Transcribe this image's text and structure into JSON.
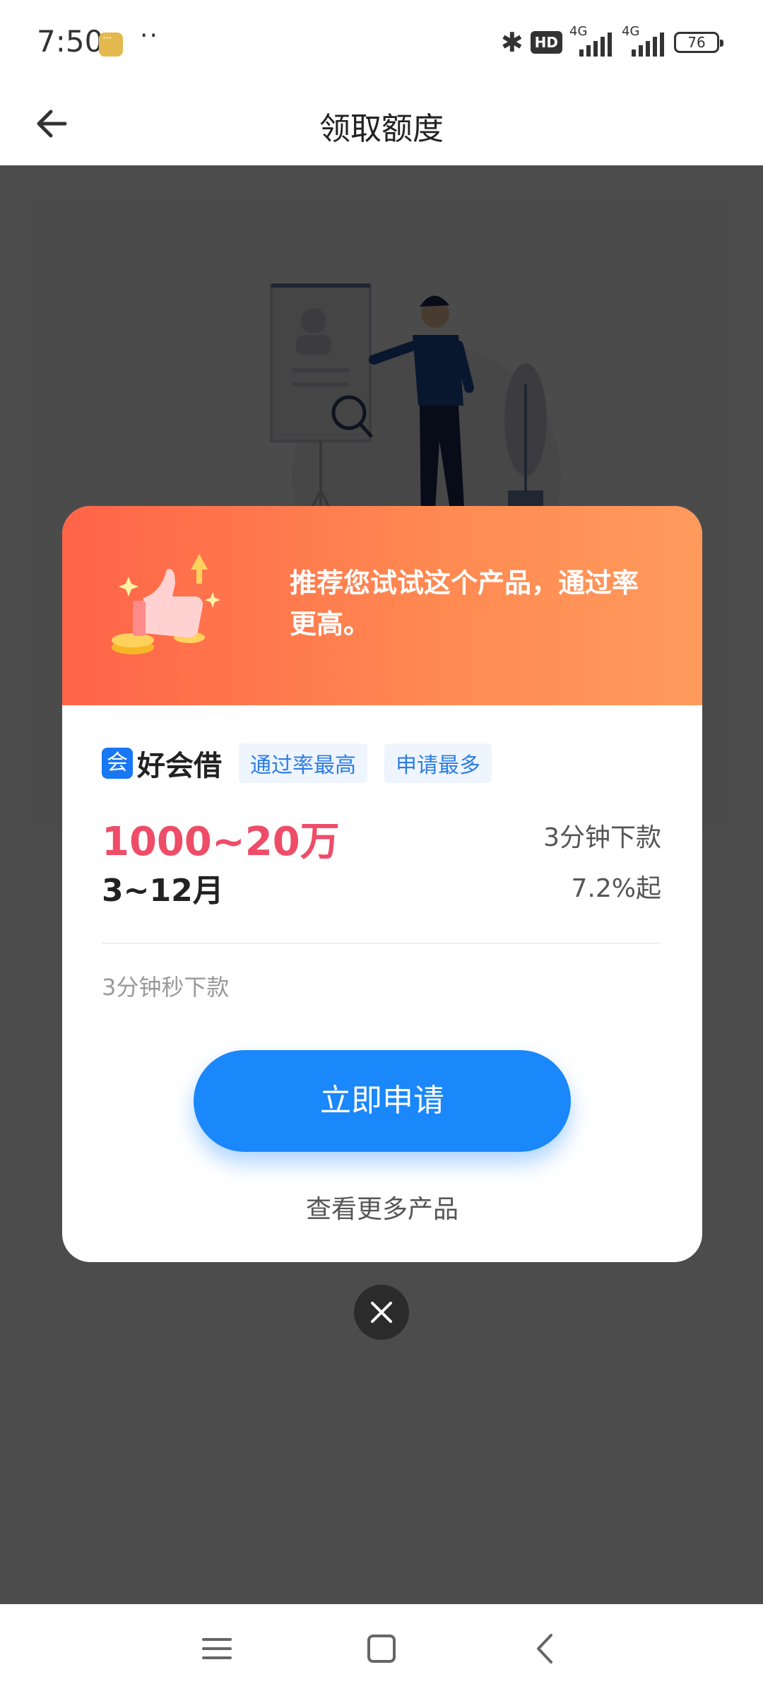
{
  "status_bar": {
    "time": "7:50",
    "dots": "··",
    "bluetooth": "✱",
    "hd": "HD",
    "network_1": "4G",
    "network_2": "4G",
    "battery": "76"
  },
  "header": {
    "title": "领取额度",
    "back_icon": "arrow-left-icon"
  },
  "modal": {
    "recommend_text": "推荐您试试这个产品，通过率更高。",
    "product_logo_icon": "haohuijie-logo-icon",
    "product_logo_glyph": "会",
    "product_name": "好会借",
    "tags": [
      "通过率最高",
      "申请最多"
    ],
    "amount_range": "1000~20万",
    "term": "3~12月",
    "speed": "3分钟下款",
    "rate": "7.2%起",
    "feature": "3分钟秒下款",
    "apply_label": "立即申请",
    "more_label": "查看更多产品",
    "close_icon": "close-icon"
  },
  "nav_bar": {
    "menu_icon": "menu-icon",
    "home_icon": "square-home-icon",
    "back_icon": "chevron-left-icon"
  },
  "colors": {
    "accent_blue": "#1a87fb",
    "amount_red": "#ef4c68",
    "header_gradient_start": "#ff6448",
    "header_gradient_end": "#ff9a5c"
  }
}
